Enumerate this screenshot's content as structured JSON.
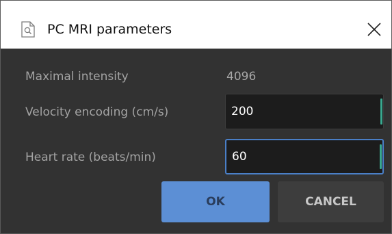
{
  "window": {
    "title": "PC MRI parameters",
    "close_label": "×"
  },
  "form": {
    "max_intensity_label": "Maximal intensity",
    "max_intensity_value": "4096",
    "velocity_label": "Velocity encoding (cm/s)",
    "velocity_value": "200",
    "heart_rate_label": "Heart rate (beats/min)",
    "heart_rate_value": "60"
  },
  "buttons": {
    "ok_label": "OK",
    "cancel_label": "CANCEL"
  },
  "icons": {
    "app": "document-search-icon",
    "close": "close-icon"
  },
  "colors": {
    "accent": "#5c8fd5",
    "focus_border": "#4a7fc7",
    "field_marker": "#39a88f",
    "background": "#323232"
  }
}
